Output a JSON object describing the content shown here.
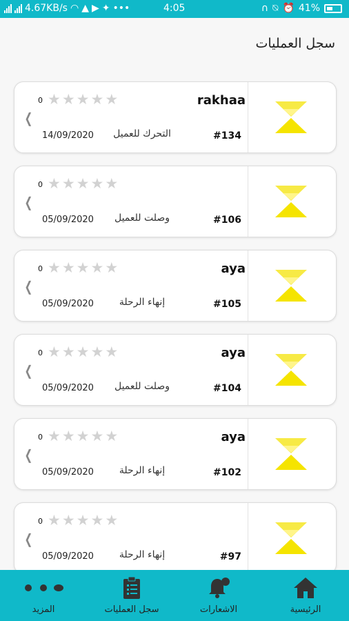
{
  "status_bar": {
    "network_speed": "4.67KB/s",
    "time": "4:05",
    "battery": "41%"
  },
  "page": {
    "title": "سجل العمليات"
  },
  "orders": [
    {
      "name": "rakhaa",
      "order_no": "#134",
      "status": "التحرك للعميل",
      "date": "14/09/2020",
      "rating_count": "0",
      "rating": 0
    },
    {
      "name": "",
      "order_no": "#106",
      "status": "وصلت للعميل",
      "date": "05/09/2020",
      "rating_count": "0",
      "rating": 0
    },
    {
      "name": "aya",
      "order_no": "#105",
      "status": "إنهاء الرحلة",
      "date": "05/09/2020",
      "rating_count": "0",
      "rating": 0
    },
    {
      "name": "aya",
      "order_no": "#104",
      "status": "وصلت للعميل",
      "date": "05/09/2020",
      "rating_count": "0",
      "rating": 0
    },
    {
      "name": "aya",
      "order_no": "#102",
      "status": "إنهاء الرحلة",
      "date": "05/09/2020",
      "rating_count": "0",
      "rating": 0
    },
    {
      "name": "",
      "order_no": "#97",
      "status": "إنهاء الرحلة",
      "date": "05/09/2020",
      "rating_count": "0",
      "rating": 0
    }
  ],
  "bottom_nav": {
    "home": {
      "label": "الرئيسية",
      "icon": "home-icon"
    },
    "notifications": {
      "label": "الاشعارات",
      "icon": "bell-icon"
    },
    "history": {
      "label": "سجل العمليات",
      "icon": "clipboard-icon"
    },
    "more": {
      "label": "المزيد",
      "icon": "more-dots-icon"
    }
  },
  "colors": {
    "primary": "#10b9c9",
    "logo_yellow": "#f5e400",
    "star_empty": "#d2d2d2"
  }
}
